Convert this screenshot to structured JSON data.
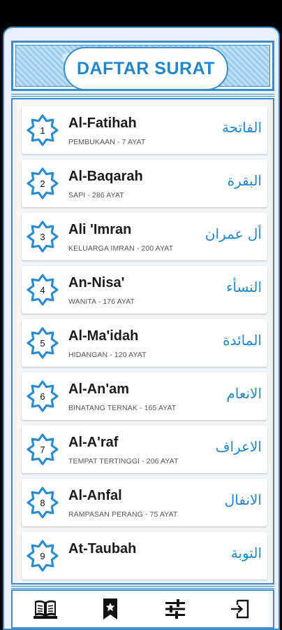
{
  "header": {
    "title": "DAFTAR SURAT"
  },
  "surahs": [
    {
      "number": "1",
      "name": "Al-Fatihah",
      "meaning": "PEMBUKAAN - 7 AYAT",
      "arabic": "الفاتحة"
    },
    {
      "number": "2",
      "name": "Al-Baqarah",
      "meaning": "SAPI - 286 AYAT",
      "arabic": "البقرة"
    },
    {
      "number": "3",
      "name": "Ali 'Imran",
      "meaning": "KELUARGA IMRAN - 200 AYAT",
      "arabic": "أل عمران"
    },
    {
      "number": "4",
      "name": "An-Nisa'",
      "meaning": "WANITA - 176 AYAT",
      "arabic": "النسأء"
    },
    {
      "number": "5",
      "name": "Al-Ma'idah",
      "meaning": "HIDANGAN - 120 AYAT",
      "arabic": "المائدة"
    },
    {
      "number": "6",
      "name": "Al-An'am",
      "meaning": "BINATANG TERNAK - 165 AYAT",
      "arabic": "الانعام"
    },
    {
      "number": "7",
      "name": "Al-A'raf",
      "meaning": "TEMPAT TERTINGGI - 206 AYAT",
      "arabic": "الاعراف"
    },
    {
      "number": "8",
      "name": "Al-Anfal",
      "meaning": "RAMPASAN PERANG - 75 AYAT",
      "arabic": "الانفال"
    },
    {
      "number": "9",
      "name": "At-Taubah",
      "meaning": "",
      "arabic": "التوبة"
    }
  ],
  "bottom_nav": [
    {
      "icon": "quran-book-icon"
    },
    {
      "icon": "bookmark-star-icon"
    },
    {
      "icon": "settings-sliders-icon"
    },
    {
      "icon": "exit-icon"
    }
  ],
  "colors": {
    "accent": "#1f86c9",
    "frame": "#3a8bc6",
    "background": "#e9f1f8"
  }
}
